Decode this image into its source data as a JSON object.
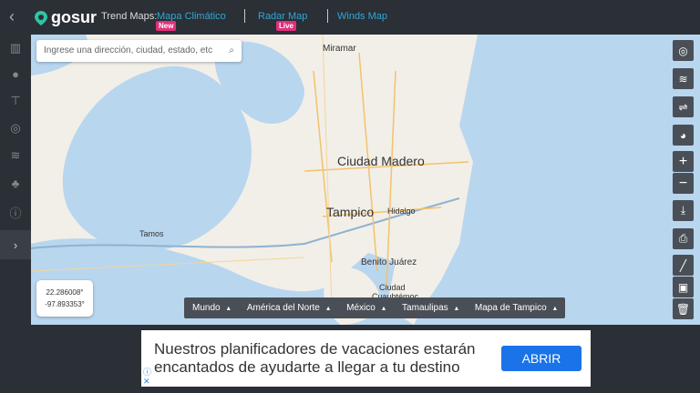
{
  "header": {
    "back": "‹",
    "brand": "gosur",
    "trend_label": "Trend Maps:",
    "links": [
      {
        "label": "Mapa Climático",
        "badge": "New"
      },
      {
        "label": "Radar Map",
        "badge": "Live"
      },
      {
        "label": "Winds Map"
      }
    ]
  },
  "sidebar": {
    "items": [
      "map-icon",
      "globe-icon",
      "signpost-icon",
      "compass-icon",
      "weather-icon",
      "satellite-icon",
      "info-icon",
      "expand-icon"
    ]
  },
  "search": {
    "placeholder": "Ingrese una dirección, ciudad, estado, etc",
    "icon": "search-icon"
  },
  "map": {
    "labels": [
      "Miramar",
      "Ciudad Madero",
      "Tampico",
      "Hidalgo",
      "Tamos",
      "Benito Juárez",
      "Ciudad",
      "Cuauhtémoc"
    ],
    "coords": {
      "lat": "22.286008°",
      "lon": "-97.893353°"
    },
    "breadcrumbs": [
      "Mundo",
      "América del Norte",
      "México",
      "Tamaulipas",
      "Mapa de Tampico"
    ],
    "tools": [
      "locate-icon",
      "layers-icon",
      "wind-icon",
      "chart-icon",
      "zoom-in-icon",
      "zoom-out-icon",
      "download-icon",
      "print-icon",
      "draw-icon",
      "crop-icon",
      "trash-icon"
    ]
  },
  "ad": {
    "text_line1": "Nuestros planificadores de vacaciones estarán",
    "text_line2": "encantados de ayudarte a llegar a tu destino",
    "button": "ABRIR",
    "info": "ⓘ",
    "close": "✕"
  },
  "colors": {
    "water": "#b9d6ef",
    "land": "#f2efe8",
    "accent": "#2fa8d8",
    "badge": "#e0307a"
  }
}
